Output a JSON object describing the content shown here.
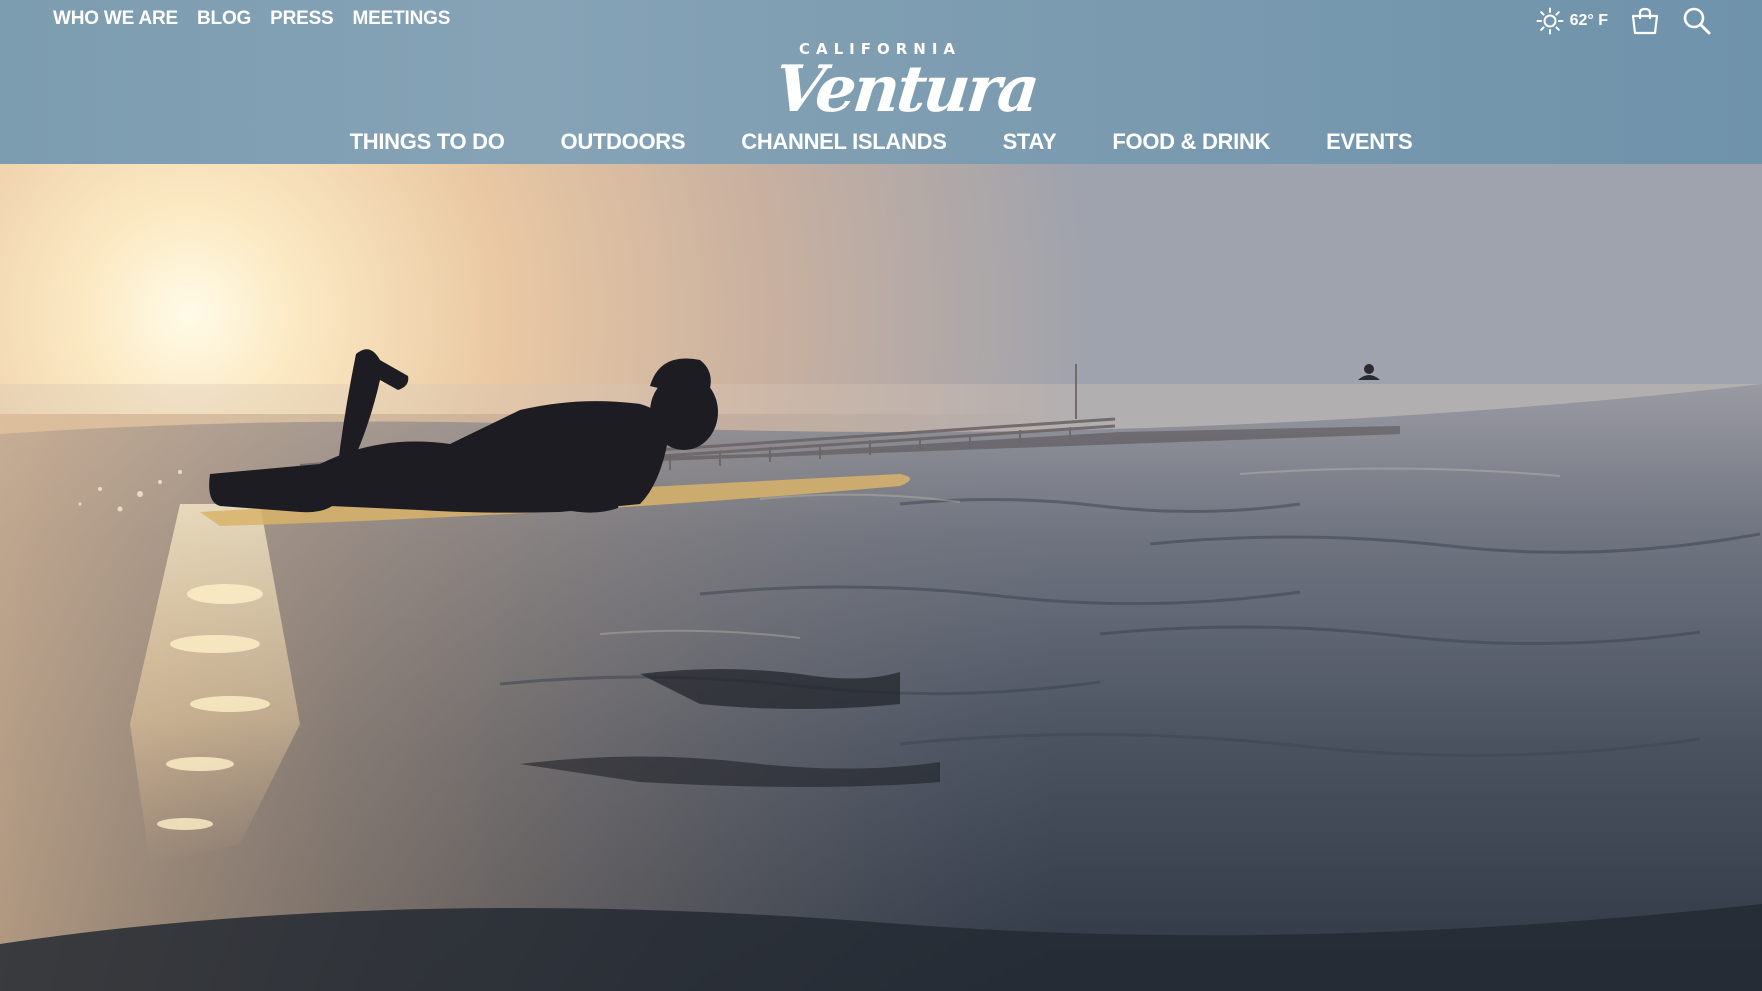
{
  "header": {
    "utility_nav": [
      {
        "label": "WHO WE ARE"
      },
      {
        "label": "BLOG"
      },
      {
        "label": "PRESS"
      },
      {
        "label": "MEETINGS"
      }
    ],
    "weather": {
      "icon": "sun-icon",
      "temperature": "62° F"
    },
    "tools": {
      "cart_icon": "shopping-bag-icon",
      "search_icon": "search-icon"
    },
    "logo": {
      "top_text": "CALIFORNIA",
      "script_text": "Ventura"
    },
    "main_nav": [
      {
        "label": "THINGS TO DO"
      },
      {
        "label": "OUTDOORS"
      },
      {
        "label": "CHANNEL ISLANDS"
      },
      {
        "label": "STAY"
      },
      {
        "label": "FOOD & DRINK"
      },
      {
        "label": "EVENTS"
      }
    ]
  },
  "colors": {
    "header_bg": "#7c9cb0",
    "nav_text": "#ffffff"
  }
}
